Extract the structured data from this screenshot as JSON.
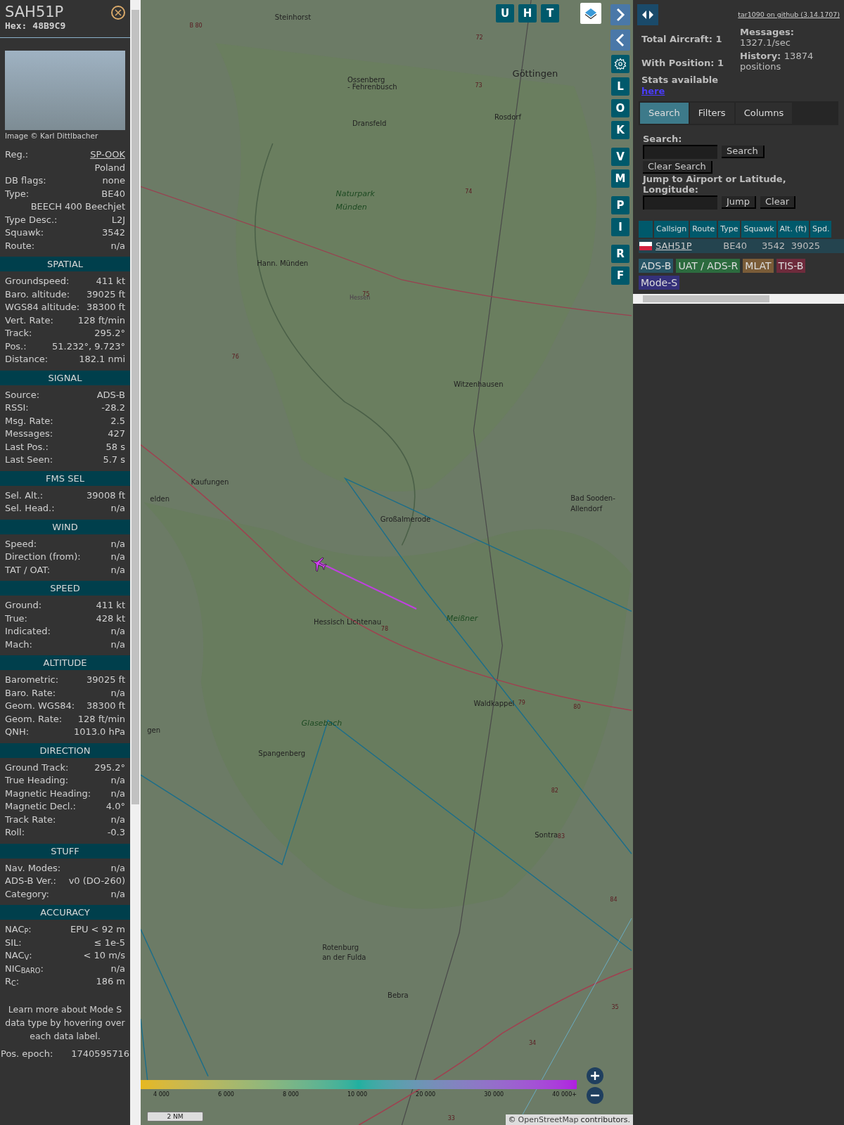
{
  "aircraft": {
    "callsign": "SAH51P",
    "hex_label": "Hex:",
    "hex": "48B9C9",
    "photo_caption": "Image © Karl Dittlbacher"
  },
  "info_rows": [
    {
      "label": "Reg.:",
      "value": "SP-OOK",
      "kind": "link"
    },
    {
      "value": "Poland",
      "kind": "continuation"
    },
    {
      "label": "DB flags:",
      "value": "none",
      "kind": "text"
    },
    {
      "label": "Type:",
      "value": "BE40",
      "kind": "text"
    },
    {
      "value": "BEECH 400 Beechjet",
      "kind": "continuation"
    },
    {
      "label": "Type Desc.:",
      "value": "L2J",
      "kind": "text"
    },
    {
      "label": "Squawk:",
      "value": "3542",
      "kind": "text"
    },
    {
      "label": "Route:",
      "value": "n/a",
      "kind": "text"
    }
  ],
  "sections": [
    {
      "title": "SPATIAL",
      "rows": [
        {
          "label": "Groundspeed:",
          "value": "411 kt"
        },
        {
          "label": "Baro. altitude:",
          "value": "39025 ft"
        },
        {
          "label": "WGS84 altitude:",
          "value": "38300 ft"
        },
        {
          "label": "Vert. Rate:",
          "value": "128 ft/min"
        },
        {
          "label": "Track:",
          "value": "295.2°"
        },
        {
          "label": "Pos.:",
          "value": "51.232°, 9.723°"
        },
        {
          "label": "Distance:",
          "value": "182.1 nmi"
        }
      ]
    },
    {
      "title": "SIGNAL",
      "rows": [
        {
          "label": "Source:",
          "value": "ADS-B"
        },
        {
          "label": "RSSI:",
          "value": "-28.2"
        },
        {
          "label": "Msg. Rate:",
          "value": "2.5"
        },
        {
          "label": "Messages:",
          "value": "427"
        },
        {
          "label": "Last Pos.:",
          "value": "58 s"
        },
        {
          "label": "Last Seen:",
          "value": "5.7 s"
        }
      ]
    },
    {
      "title": "FMS SEL",
      "rows": [
        {
          "label": "Sel. Alt.:",
          "value": "39008 ft"
        },
        {
          "label": "Sel. Head.:",
          "value": "n/a"
        }
      ]
    },
    {
      "title": "WIND",
      "rows": [
        {
          "label": "Speed:",
          "value": "n/a"
        },
        {
          "label": "Direction (from):",
          "value": "n/a"
        },
        {
          "label": "TAT / OAT:",
          "value": "n/a"
        }
      ]
    },
    {
      "title": "SPEED",
      "rows": [
        {
          "label": "Ground:",
          "value": "411 kt"
        },
        {
          "label": "True:",
          "value": "428 kt"
        },
        {
          "label": "Indicated:",
          "value": "n/a"
        },
        {
          "label": "Mach:",
          "value": "n/a"
        }
      ]
    },
    {
      "title": "ALTITUDE",
      "rows": [
        {
          "label": "Barometric:",
          "value": "39025 ft"
        },
        {
          "label": "Baro. Rate:",
          "value": "n/a"
        },
        {
          "label": "Geom. WGS84:",
          "value": "38300 ft"
        },
        {
          "label": "Geom. Rate:",
          "value": "128 ft/min"
        },
        {
          "label": "QNH:",
          "value": "1013.0 hPa"
        }
      ]
    },
    {
      "title": "DIRECTION",
      "rows": [
        {
          "label": "Ground Track:",
          "value": "295.2°"
        },
        {
          "label": "True Heading:",
          "value": "n/a"
        },
        {
          "label": "Magnetic Heading:",
          "value": "n/a"
        },
        {
          "label": "Magnetic Decl.:",
          "value": "4.0°"
        },
        {
          "label": "Track Rate:",
          "value": "n/a"
        },
        {
          "label": "Roll:",
          "value": "-0.3"
        }
      ]
    },
    {
      "title": "STUFF",
      "rows": [
        {
          "label": "Nav. Modes:",
          "value": "n/a"
        },
        {
          "label": "ADS-B Ver.:",
          "value": "v0 (DO-260)"
        },
        {
          "label": "Category:",
          "value": "n/a"
        }
      ]
    },
    {
      "title": "ACCURACY",
      "rows": [
        {
          "label": "NAC$_{P}$:",
          "value": "EPU < 92 m"
        },
        {
          "label": "SIL:",
          "value": "≤ 1e-5"
        },
        {
          "label": "NAC$_{V}$:",
          "value": "< 10 m/s"
        },
        {
          "label": "NIC$_{BARO}$:",
          "value": "n/a"
        },
        {
          "label": "R$_{C}$:",
          "value": "186 m"
        }
      ]
    }
  ],
  "footnote": "Learn more about Mode S data type by hovering over each data label.",
  "pos_epoch": {
    "label": "Pos. epoch:",
    "value": "1740595716"
  },
  "map": {
    "labels": [
      {
        "text": "Steinhorst",
        "kind": "town"
      },
      {
        "text": "B 80",
        "kind": "road"
      },
      {
        "text": "72",
        "kind": "road"
      },
      {
        "text": "Göttingen",
        "kind": "city"
      },
      {
        "text": "Ossenberg",
        "kind": "town"
      },
      {
        "text": "- Fehrenbusch",
        "kind": "town"
      },
      {
        "text": "73",
        "kind": "road"
      },
      {
        "text": "Rosdorf",
        "kind": "town"
      },
      {
        "text": "Dransfeld",
        "kind": "town"
      },
      {
        "text": "Naturpark",
        "kind": "park"
      },
      {
        "text": "Münden",
        "kind": "park"
      },
      {
        "text": "74",
        "kind": "road"
      },
      {
        "text": "Hann. Münden",
        "kind": "town"
      },
      {
        "text": "75",
        "kind": "road"
      },
      {
        "text": "Hessen",
        "kind": "border"
      },
      {
        "text": "76",
        "kind": "road"
      },
      {
        "text": "Witzenhausen",
        "kind": "town"
      },
      {
        "text": "Kaufungen",
        "kind": "town"
      },
      {
        "text": "elden",
        "kind": "town"
      },
      {
        "text": "Bad Sooden-",
        "kind": "town"
      },
      {
        "text": "Allendorf",
        "kind": "town"
      },
      {
        "text": "Großalmerode",
        "kind": "town"
      },
      {
        "text": "Hessisch Lichtenau",
        "kind": "town"
      },
      {
        "text": "Meißner",
        "kind": "park"
      },
      {
        "text": "78",
        "kind": "road"
      },
      {
        "text": "Waldkappel",
        "kind": "town"
      },
      {
        "text": "79",
        "kind": "road"
      },
      {
        "text": "80",
        "kind": "road"
      },
      {
        "text": "Glasebach",
        "kind": "park"
      },
      {
        "text": "gen",
        "kind": "town"
      },
      {
        "text": "Spangenberg",
        "kind": "town"
      },
      {
        "text": "82",
        "kind": "road"
      },
      {
        "text": "Sontra",
        "kind": "town"
      },
      {
        "text": "83",
        "kind": "road"
      },
      {
        "text": "84",
        "kind": "road"
      },
      {
        "text": "Rotenburg",
        "kind": "town"
      },
      {
        "text": "an der Fulda",
        "kind": "town"
      },
      {
        "text": "Bebra",
        "kind": "town"
      },
      {
        "text": "35",
        "kind": "road"
      },
      {
        "text": "34",
        "kind": "road"
      },
      {
        "text": "33",
        "kind": "road"
      }
    ],
    "top_buttons": [
      "U",
      "H",
      "T"
    ],
    "side_button_groups": [
      [
        "L",
        "O",
        "K"
      ],
      [
        "V",
        "M"
      ],
      [
        "P",
        "I"
      ],
      [
        "R",
        "F"
      ]
    ],
    "legend_ticks": [
      "4 000",
      "6 000",
      "8 000",
      "10 000",
      "20 000",
      "30 000",
      "40 000+"
    ],
    "scale": "2 NM",
    "attribution_symbol": "©",
    "attribution_link": "OpenStreetMap",
    "attribution_text": "contributors."
  },
  "panel": {
    "github_link": "tar1090 on github (3.14.1707)",
    "stats": [
      {
        "label": "Total Aircraft:",
        "value": "1"
      },
      {
        "label": "Messages:",
        "value": "1327.1/sec"
      },
      {
        "label": "With Position:",
        "value": "1"
      },
      {
        "label": "History:",
        "value": "13874 positions"
      }
    ],
    "stats_note": "Stats available",
    "stats_link": "here",
    "tabs": [
      {
        "label": "Search",
        "selected": true
      },
      {
        "label": "Filters",
        "selected": false
      },
      {
        "label": "Columns",
        "selected": false
      }
    ],
    "search_label": "Search:",
    "search_button": "Search",
    "clear_search_button": "Clear Search",
    "jump_label": "Jump to Airport or Latitude, Longitude:",
    "jump_button": "Jump",
    "clear_button": "Clear",
    "table": {
      "columns": [
        "Callsign",
        "Route",
        "Type",
        "Squawk",
        "Alt. (ft)",
        "Spd."
      ],
      "rows": [
        {
          "callsign": "SAH51P",
          "type": "BE40",
          "squawk": "3542",
          "altitude": "39025",
          "selected": true
        }
      ]
    },
    "sources": [
      {
        "label": "ADS-B",
        "color": "#285566"
      },
      {
        "label": "UAT / ADS-R",
        "color": "#2c6b3e"
      },
      {
        "label": "MLAT",
        "color": "#7a5c38"
      },
      {
        "label": "TIS-B",
        "color": "#6e2b3c"
      },
      {
        "label": "Mode-S",
        "color": "#35317a"
      }
    ]
  }
}
